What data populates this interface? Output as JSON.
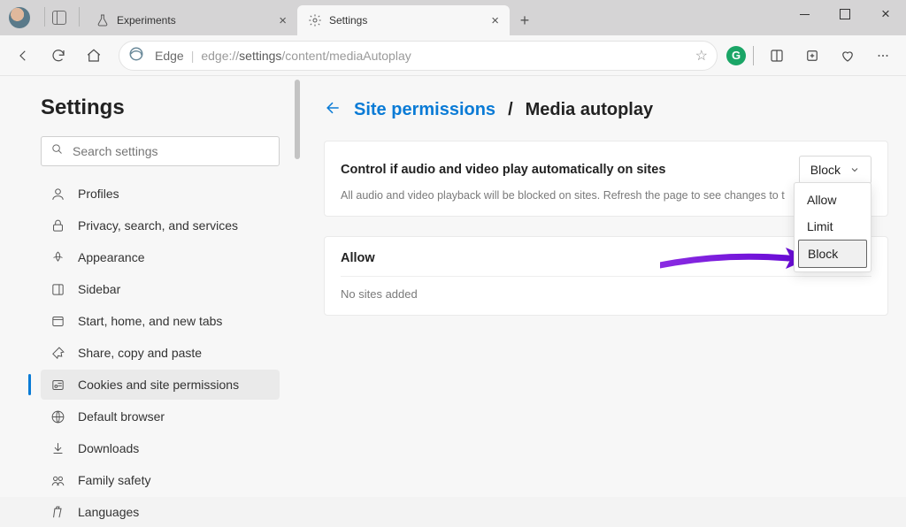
{
  "tabs": [
    {
      "label": "Experiments",
      "icon": "flask"
    },
    {
      "label": "Settings",
      "icon": "gear"
    }
  ],
  "url_prefix": "edge://",
  "url_bold": "settings",
  "url_rest": "/content/mediaAutoplay",
  "edge_label": "Edge",
  "extension_letter": "G",
  "settings_title": "Settings",
  "search_placeholder": "Search settings",
  "nav": [
    "Profiles",
    "Privacy, search, and services",
    "Appearance",
    "Sidebar",
    "Start, home, and new tabs",
    "Share, copy and paste",
    "Cookies and site permissions",
    "Default browser",
    "Downloads",
    "Family safety",
    "Languages"
  ],
  "nav_active_index": 6,
  "breadcrumb": {
    "parent": "Site permissions",
    "current": "Media autoplay"
  },
  "control_card": {
    "title": "Control if audio and video play automatically on sites",
    "desc": "All audio and video playback will be blocked on sites. Refresh the page to see changes to t",
    "selected": "Block",
    "options": [
      "Allow",
      "Limit",
      "Block"
    ]
  },
  "allow_card": {
    "title": "Allow",
    "empty": "No sites added"
  }
}
